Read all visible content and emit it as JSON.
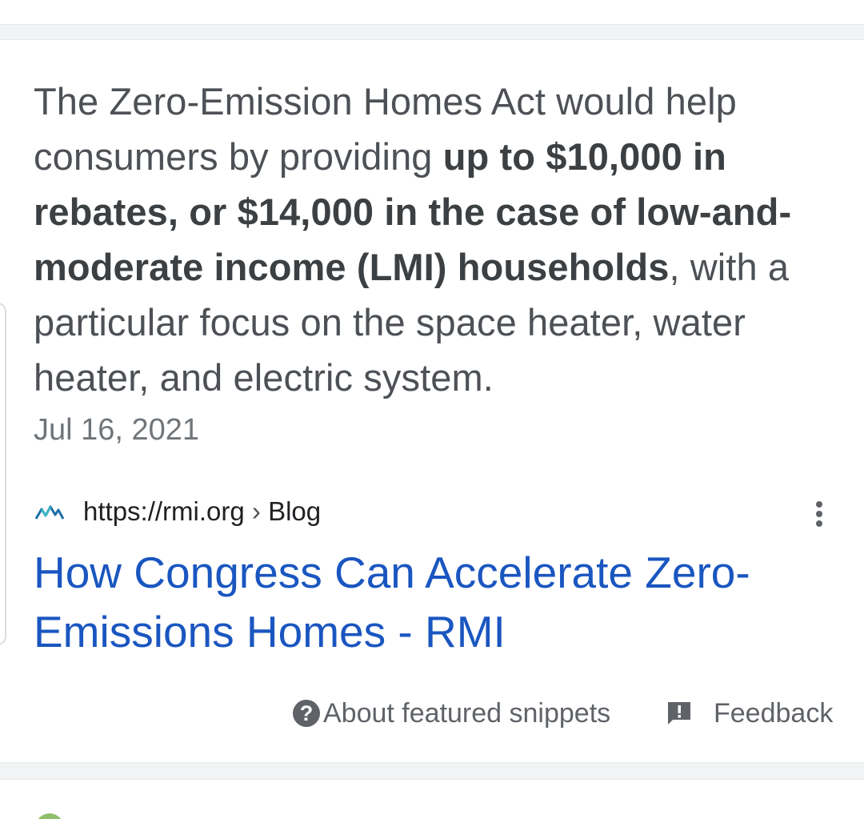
{
  "snippet": {
    "text_before": "The Zero-Emission Homes Act would help consumers by providing ",
    "text_bold": "up to $10,000 in rebates, or $14,000 in the case of low-and-moderate income (LMI) households",
    "text_after": ", with a particular focus on the space heater, water heater, and electric system.",
    "date": "Jul 16, 2021"
  },
  "source": {
    "url": "https://rmi.org",
    "separator": "›",
    "path": "Blog",
    "favicon": "rmi-logo-icon"
  },
  "result": {
    "title": "How Congress Can Accelerate Zero-Emissions Homes - RMI"
  },
  "footer": {
    "about_label": "About featured snippets",
    "feedback_label": "Feedback",
    "about_icon": "help-circle-icon",
    "feedback_icon": "feedback-icon"
  },
  "colors": {
    "link": "#1a56c0",
    "text": "#4d5156",
    "muted": "#70757a",
    "divider": "#f1f3f4"
  }
}
